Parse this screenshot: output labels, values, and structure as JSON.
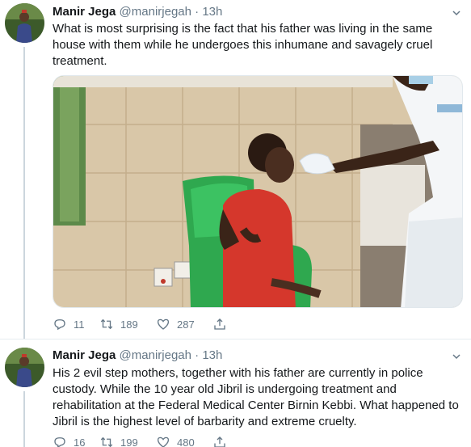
{
  "tweets": [
    {
      "name": "Manir Jega",
      "handle": "@manirjegah",
      "dot": "·",
      "time": "13h",
      "text": "What is most surprising is the fact that his father was living in the same house with them while he undergoes this inhumane and savagely cruel treatment.",
      "replies": "11",
      "retweets": "189",
      "likes": "287"
    },
    {
      "name": "Manir Jega",
      "handle": "@manirjegah",
      "dot": "·",
      "time": "13h",
      "text": "His 2 evil step mothers, together with his father are currently in police custody. While the 10 year old Jibril is undergoing treatment and rehabilitation at the Federal Medical Center Birnin Kebbi. What happened to Jibril is the highest level of barbarity and extreme cruelty.",
      "replies": "16",
      "retweets": "199",
      "likes": "480"
    }
  ],
  "icons": {
    "reply": "reply-icon",
    "retweet": "retweet-icon",
    "like": "like-icon",
    "share": "share-icon",
    "more": "chevron-down-icon"
  },
  "colors": {
    "text": "#14171a",
    "secondary": "#657786",
    "thread_line": "#ccd6dd"
  }
}
